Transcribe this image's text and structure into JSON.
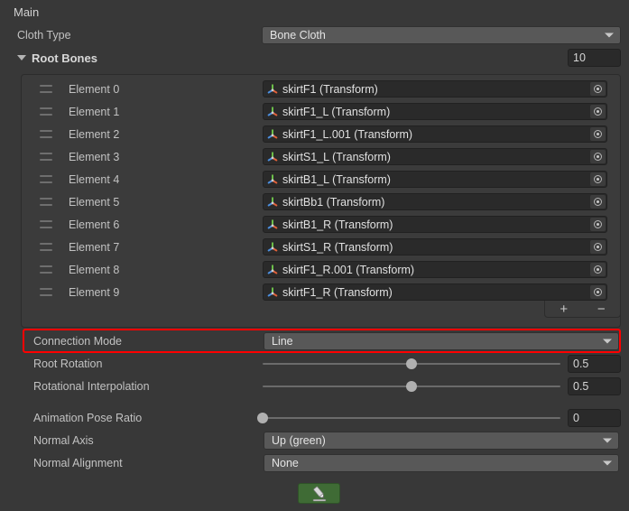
{
  "section": {
    "title": "Main"
  },
  "cloth_type": {
    "label": "Cloth Type",
    "value": "Bone Cloth"
  },
  "root_bones": {
    "label": "Root Bones",
    "size": "10",
    "add_label": "+",
    "remove_label": "−",
    "elements": [
      {
        "index": "Element 0",
        "value": "skirtF1 (Transform)"
      },
      {
        "index": "Element 1",
        "value": "skirtF1_L (Transform)"
      },
      {
        "index": "Element 2",
        "value": "skirtF1_L.001 (Transform)"
      },
      {
        "index": "Element 3",
        "value": "skirtS1_L (Transform)"
      },
      {
        "index": "Element 4",
        "value": "skirtB1_L (Transform)"
      },
      {
        "index": "Element 5",
        "value": "skirtBb1 (Transform)"
      },
      {
        "index": "Element 6",
        "value": "skirtB1_R (Transform)"
      },
      {
        "index": "Element 7",
        "value": "skirtS1_R (Transform)"
      },
      {
        "index": "Element 8",
        "value": "skirtF1_R.001 (Transform)"
      },
      {
        "index": "Element 9",
        "value": "skirtF1_R (Transform)"
      }
    ]
  },
  "connection_mode": {
    "label": "Connection Mode",
    "value": "Line",
    "highlighted": true
  },
  "root_rotation": {
    "label": "Root Rotation",
    "value": "0.5",
    "fraction": 0.5
  },
  "rotational_interpolation": {
    "label": "Rotational Interpolation",
    "value": "0.5",
    "fraction": 0.5
  },
  "animation_pose_ratio": {
    "label": "Animation Pose Ratio",
    "value": "0",
    "fraction": 0.0
  },
  "normal_axis": {
    "label": "Normal Axis",
    "value": "Up (green)"
  },
  "normal_alignment": {
    "label": "Normal Alignment",
    "value": "None"
  },
  "edit_button": {
    "icon": "pencil-icon",
    "color": "#3f6b35"
  },
  "colors": {
    "background": "#383838",
    "list_background": "#3b3b3b",
    "popup": "#585858",
    "field": "#2a2a2a",
    "highlight": "#ff0000",
    "text": "#c2c2c2"
  }
}
